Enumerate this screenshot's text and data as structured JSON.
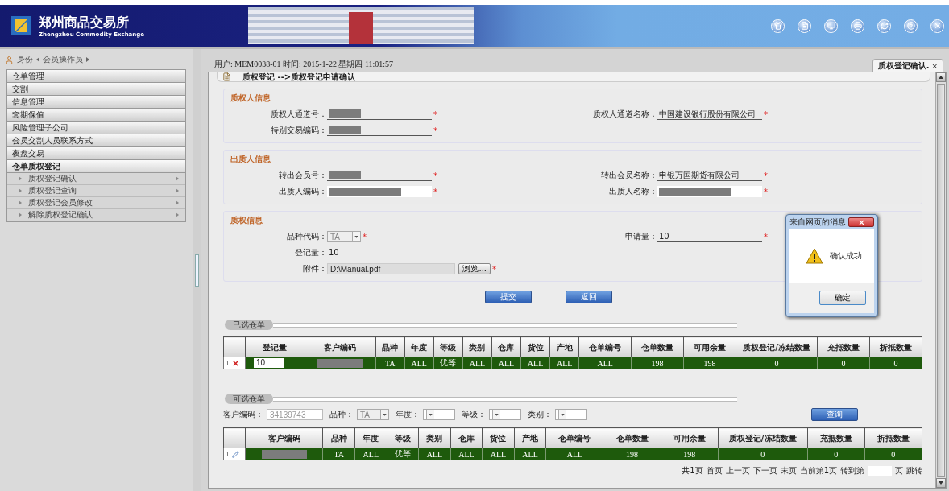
{
  "header": {
    "logo_title": "郑州商品交易所",
    "logo_subtitle": "Zhengzhou Commodity Exchange"
  },
  "sidebar": {
    "identity_label": "身份",
    "role": "会员操作员",
    "groups": [
      {
        "label": "仓单管理",
        "expanded": false
      },
      {
        "label": "交割",
        "expanded": false
      },
      {
        "label": "信息管理",
        "expanded": false
      },
      {
        "label": "套期保值",
        "expanded": false
      },
      {
        "label": "风险管理子公司",
        "expanded": false
      },
      {
        "label": "会员交割人员联系方式",
        "expanded": false
      },
      {
        "label": "夜盘交易",
        "expanded": false
      },
      {
        "label": "仓单质权登记",
        "expanded": true,
        "children": [
          {
            "label": "质权登记确认"
          },
          {
            "label": "质权登记查询"
          },
          {
            "label": "质权登记会员修改"
          },
          {
            "label": "解除质权登记确认"
          }
        ]
      }
    ]
  },
  "main": {
    "user_info": "用户: MEM0038-01 时间: 2015-1-22 星期四 11:01:57",
    "tab": {
      "label": "质权登记确认.",
      "close": "×",
      "selected": true
    },
    "breadcrumb": "质权登记 -->质权登记申请确认",
    "sections": [
      {
        "title": "质权人信息",
        "rows": [
          {
            "left": {
              "label": "质权人通道号：",
              "kind": "redacted",
              "mark": "*"
            },
            "right": {
              "label": "质权人通道名称：",
              "kind": "text",
              "value": "中国建设银行股份有限公司",
              "mark": "*"
            }
          },
          {
            "left": {
              "label": "特别交易编码：",
              "kind": "redacted",
              "mark": "*"
            }
          }
        ]
      },
      {
        "title": "出质人信息",
        "rows": [
          {
            "left": {
              "label": "转出会员号：",
              "kind": "redacted",
              "mark": "*"
            },
            "right": {
              "label": "转出会员名称：",
              "kind": "text",
              "value": "申银万国期货有限公司",
              "mark": "*"
            }
          },
          {
            "left": {
              "label": "出质人编码：",
              "kind": "redacted-box",
              "mark": "*"
            },
            "right": {
              "label": "出质人名称：",
              "kind": "redacted-box",
              "mark": "*"
            }
          }
        ]
      },
      {
        "title": "质权信息",
        "rows": [
          {
            "left": {
              "label": "品种代码：",
              "kind": "select",
              "value": "TA",
              "disabled": true,
              "mark": "*"
            },
            "right": {
              "label": "申请量：",
              "kind": "text",
              "value": "10",
              "mark": "*"
            }
          },
          {
            "left": {
              "label": "登记量：",
              "kind": "text",
              "value": "10"
            }
          },
          {
            "left": {
              "label": "附件：",
              "kind": "file",
              "value": "D:\\Manual.pdf",
              "button": "浏览...",
              "mark": "*"
            }
          }
        ]
      }
    ],
    "buttons": [
      "提交",
      "返回"
    ],
    "selected_list": {
      "title": "已选仓单",
      "columns": [
        "登记量",
        "客户编码",
        "品种",
        "年度",
        "等级",
        "类别",
        "仓库",
        "货位",
        "产地",
        "仓单编号",
        "仓单数量",
        "可用余量",
        "质权登记/冻结数量",
        "充抵数量",
        "折抵数量"
      ],
      "rows": [
        {
          "index": "1",
          "kind": "delete",
          "selected": true,
          "cells": [
            {
              "kind": "input",
              "text": "10"
            },
            {
              "kind": "redacted"
            },
            {
              "kind": "text",
              "text": "TA"
            },
            {
              "kind": "text",
              "text": "ALL"
            },
            {
              "kind": "text",
              "text": "优等"
            },
            {
              "kind": "text",
              "text": "ALL"
            },
            {
              "kind": "text",
              "text": "ALL"
            },
            {
              "kind": "text",
              "text": "ALL"
            },
            {
              "kind": "text",
              "text": "ALL"
            },
            {
              "kind": "text",
              "text": "ALL"
            },
            {
              "kind": "text",
              "text": "198"
            },
            {
              "kind": "text",
              "text": "198"
            },
            {
              "kind": "text",
              "text": "0"
            },
            {
              "kind": "text",
              "text": "0"
            },
            {
              "kind": "text",
              "text": "0"
            }
          ]
        }
      ]
    },
    "available_list": {
      "title": "可选仓单",
      "filters": [
        {
          "label": "客户编码：",
          "kind": "input",
          "value": "34139743",
          "disabled": true
        },
        {
          "label": "品种：",
          "kind": "select",
          "value": "TA",
          "disabled": true
        },
        {
          "label": "年度：",
          "kind": "select",
          "disabled": false
        },
        {
          "label": "等级：",
          "kind": "select",
          "disabled": false
        },
        {
          "label": "类别：",
          "kind": "select",
          "disabled": false
        }
      ],
      "query_button": "查询",
      "columns": [
        "客户编码",
        "品种",
        "年度",
        "等级",
        "类别",
        "仓库",
        "货位",
        "产地",
        "仓单编号",
        "仓单数量",
        "可用余量",
        "质权登记/冻结数量",
        "充抵数量",
        "折抵数量"
      ],
      "rows": [
        {
          "index": "1",
          "kind": "edit",
          "selected": true,
          "cells": [
            {
              "kind": "redacted"
            },
            {
              "kind": "text",
              "text": "TA"
            },
            {
              "kind": "text",
              "text": "ALL"
            },
            {
              "kind": "text",
              "text": "优等"
            },
            {
              "kind": "text",
              "text": "ALL"
            },
            {
              "kind": "text",
              "text": "ALL"
            },
            {
              "kind": "text",
              "text": "ALL"
            },
            {
              "kind": "text",
              "text": "ALL"
            },
            {
              "kind": "text",
              "text": "ALL"
            },
            {
              "kind": "text",
              "text": "198"
            },
            {
              "kind": "text",
              "text": "198"
            },
            {
              "kind": "text",
              "text": "0"
            },
            {
              "kind": "text",
              "text": "0"
            },
            {
              "kind": "text",
              "text": "0"
            }
          ]
        }
      ],
      "pagination": [
        {
          "kind": "text",
          "text": "共1页"
        },
        {
          "kind": "link",
          "text": "首页"
        },
        {
          "kind": "link",
          "text": "上一页"
        },
        {
          "kind": "link",
          "text": "下一页"
        },
        {
          "kind": "link",
          "text": "末页"
        },
        {
          "kind": "text",
          "text": "当前第1页"
        },
        {
          "kind": "text",
          "text": "转到第"
        },
        {
          "kind": "input"
        },
        {
          "kind": "text",
          "text": "页"
        },
        {
          "kind": "link",
          "text": "跳转"
        }
      ]
    }
  },
  "dialog": {
    "title": "来自网页的消息",
    "message": "确认成功",
    "ok": "确定"
  }
}
